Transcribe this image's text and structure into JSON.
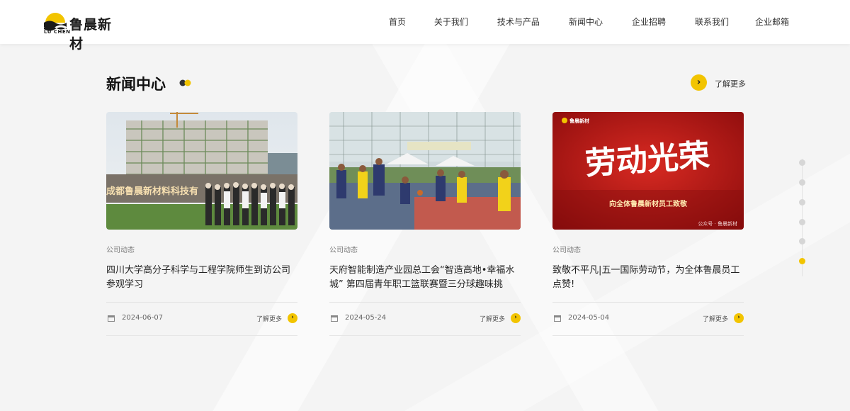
{
  "brand": {
    "name": "鲁晨新材",
    "sub": "LU CHEN",
    "accent": "#f2c400"
  },
  "nav": [
    {
      "label": "首页",
      "icon": ""
    },
    {
      "label": "关于我们"
    },
    {
      "label": "技术与产品"
    },
    {
      "label": "新闻中心"
    },
    {
      "label": "企业招聘"
    },
    {
      "label": "联系我们"
    },
    {
      "label": "企业邮箱"
    }
  ],
  "section": {
    "title": "新闻中心",
    "more_label": "了解更多",
    "more_icon": "chevron-right-icon"
  },
  "cards": [
    {
      "image": "campus-visit-photo",
      "category": "公司动态",
      "title": "四川大学高分子科学与工程学院师生到访公司参观学习",
      "date": "2024-06-07",
      "more_label": "了解更多",
      "photo_sign": "成都鲁晨新材料科技有"
    },
    {
      "image": "basketball-game-photo",
      "category": "公司动态",
      "title": "天府智能制造产业园总工会“智造高地•幸福水城” 第四届青年职工篮联赛暨三分球趣味挑战...",
      "date": "2024-05-24",
      "more_label": "了解更多"
    },
    {
      "image": "labor-day-poster",
      "category": "公司动态",
      "title": "致敬不平凡|五一国际劳动节，为全体鲁晨员工点赞!",
      "date": "2024-05-04",
      "more_label": "了解更多",
      "poster_brand": "鲁晨新材",
      "poster_headline": "劳动光荣",
      "poster_subline": "向全体鲁晨新材员工致敬",
      "poster_footer": "公众号 · 鲁晨新材"
    }
  ],
  "pager": {
    "count": 6,
    "active_index": 5
  }
}
